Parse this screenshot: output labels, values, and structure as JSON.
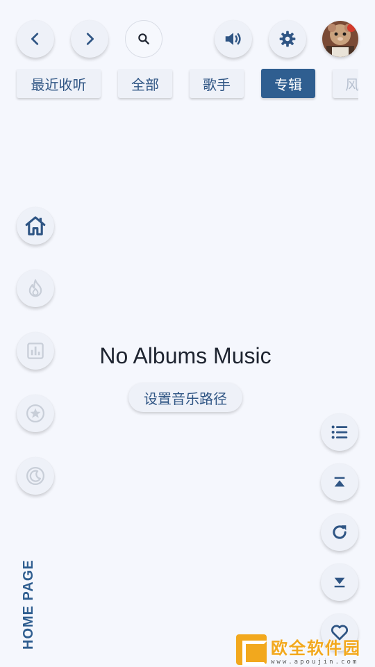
{
  "tabs": [
    {
      "label": "最近收听"
    },
    {
      "label": "全部"
    },
    {
      "label": "歌手"
    },
    {
      "label": "专辑"
    },
    {
      "label": "风"
    }
  ],
  "active_tab": "专辑",
  "empty_state": {
    "title": "No Albums Music",
    "action_label": "设置音乐路径"
  },
  "page_label": "HOME PAGE",
  "watermark": {
    "name": "欧全软件园",
    "url": "www.apoujin.com"
  },
  "icons": {
    "top": [
      "chevron-left-icon",
      "chevron-right-icon",
      "search-icon",
      "volume-icon",
      "gear-icon"
    ],
    "side": [
      "home-icon",
      "flame-icon",
      "chart-icon",
      "star-icon",
      "moon-icon"
    ],
    "right": [
      "list-icon",
      "scroll-top-icon",
      "refresh-icon",
      "scroll-bottom-icon",
      "heart-icon"
    ]
  },
  "colors": {
    "accent": "#2f5e90",
    "background": "#f5f7fd",
    "icon_inactive": "#c8ced8"
  }
}
